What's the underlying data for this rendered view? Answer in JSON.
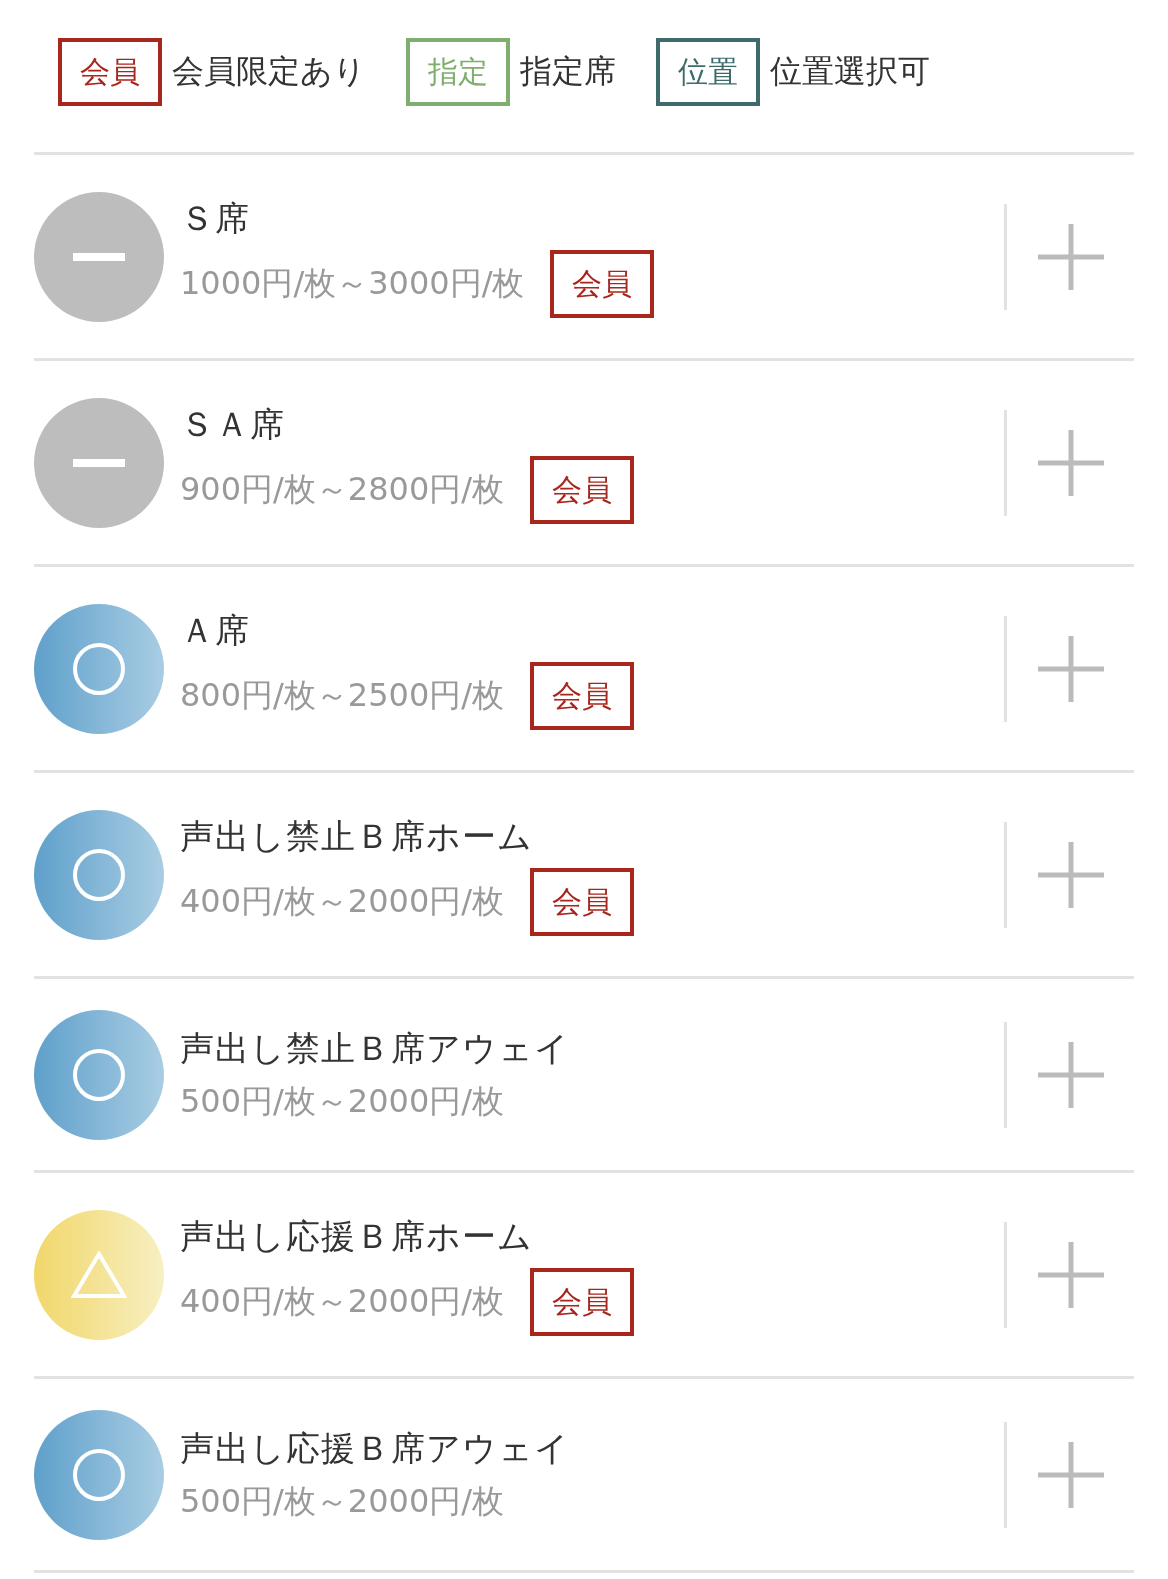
{
  "legend": [
    {
      "badge": "会員",
      "label": "会員限定あり",
      "color": "#a8261e"
    },
    {
      "badge": "指定",
      "label": "指定席",
      "color": "#7fae6e"
    },
    {
      "badge": "位置",
      "label": "位置選択可",
      "color": "#3d6b6b"
    }
  ],
  "seats": [
    {
      "name": "Ｓ席",
      "price": "1000円/枚～3000円/枚",
      "kind": "soldout",
      "member_badge": "会員"
    },
    {
      "name": "ＳＡ席",
      "price": "900円/枚～2800円/枚",
      "kind": "soldout",
      "member_badge": "会員"
    },
    {
      "name": "Ａ席",
      "price": "800円/枚～2500円/枚",
      "kind": "available",
      "member_badge": "会員"
    },
    {
      "name": "声出し禁止Ｂ席ホーム",
      "price": "400円/枚～2000円/枚",
      "kind": "available",
      "member_badge": "会員"
    },
    {
      "name": "声出し禁止Ｂ席アウェイ",
      "price": "500円/枚～2000円/枚",
      "kind": "available"
    },
    {
      "name": "声出し応援Ｂ席ホーム",
      "price": "400円/枚～2000円/枚",
      "kind": "few",
      "member_badge": "会員"
    },
    {
      "name": "声出し応援Ｂ席アウェイ",
      "price": "500円/枚～2000円/枚",
      "kind": "available"
    }
  ]
}
